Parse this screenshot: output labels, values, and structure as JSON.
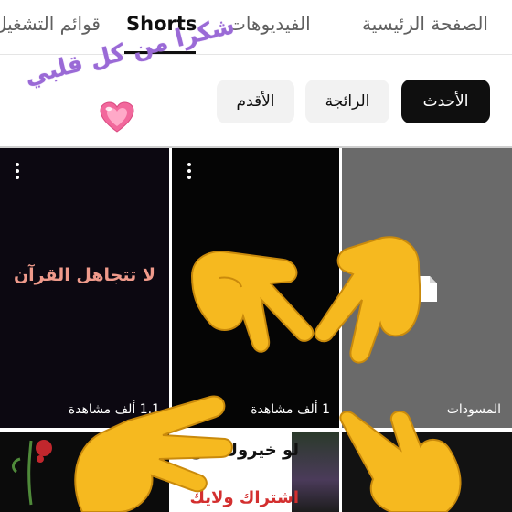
{
  "tabs": {
    "home": "الصفحة الرئيسية",
    "videos": "الفيديوهات",
    "shorts": "Shorts",
    "lists": "قوائم التشغيل"
  },
  "chips": {
    "latest": "الأحدث",
    "popular": "الرائجة",
    "oldest": "الأقدم"
  },
  "overlay": {
    "caption": "شكرا من كل قلبي",
    "heart": "heart-emoji-icon",
    "hands": "pointing-hand-emoji-icon"
  },
  "shorts": [
    {
      "title": "لا تتجاهل القرآن",
      "views": "1.1 ألف مشاهدة"
    },
    {
      "title": "",
      "views": "1 ألف مشاهدة"
    },
    {
      "title": "",
      "views": "المسودات"
    },
    {
      "title": "",
      "views": ""
    },
    {
      "title": "لو خيروك بين",
      "subtitle": "اشتراك ولايك",
      "views": ""
    },
    {
      "title": "",
      "views": ""
    }
  ],
  "colors": {
    "accent": "#0f0f0f",
    "chip_bg": "#f2f2f2",
    "caption": "#9a6ad6",
    "hand": "#f6b91f"
  }
}
